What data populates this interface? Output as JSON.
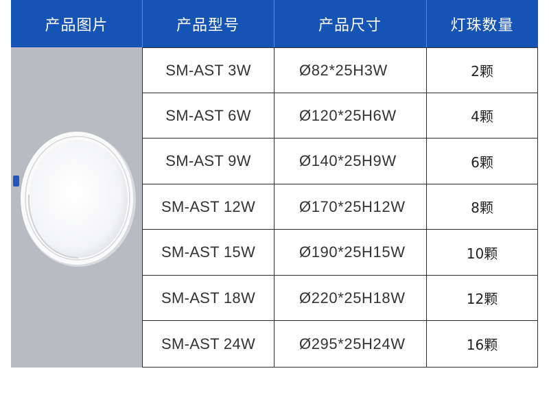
{
  "colors": {
    "header_bg": "#1554b5",
    "image_bg": "#b8bbc2",
    "text": "#333333"
  },
  "headers": [
    "产品图片",
    "产品型号",
    "产品尺寸",
    "灯珠数量"
  ],
  "image_icon": "round-led-downlight",
  "rows": [
    {
      "model": "SM-AST 3W",
      "size": "Ø82*25H3W",
      "qty": "2颗"
    },
    {
      "model": "SM-AST 6W",
      "size": "Ø120*25H6W",
      "qty": "4颗"
    },
    {
      "model": "SM-AST 9W",
      "size": "Ø140*25H9W",
      "qty": "6颗"
    },
    {
      "model": "SM-AST 12W",
      "size": "Ø170*25H12W",
      "qty": "8颗"
    },
    {
      "model": "SM-AST 15W",
      "size": "Ø190*25H15W",
      "qty": "10颗"
    },
    {
      "model": "SM-AST 18W",
      "size": "Ø220*25H18W",
      "qty": "12颗"
    },
    {
      "model": "SM-AST 24W",
      "size": "Ø295*25H24W",
      "qty": "16颗"
    }
  ]
}
